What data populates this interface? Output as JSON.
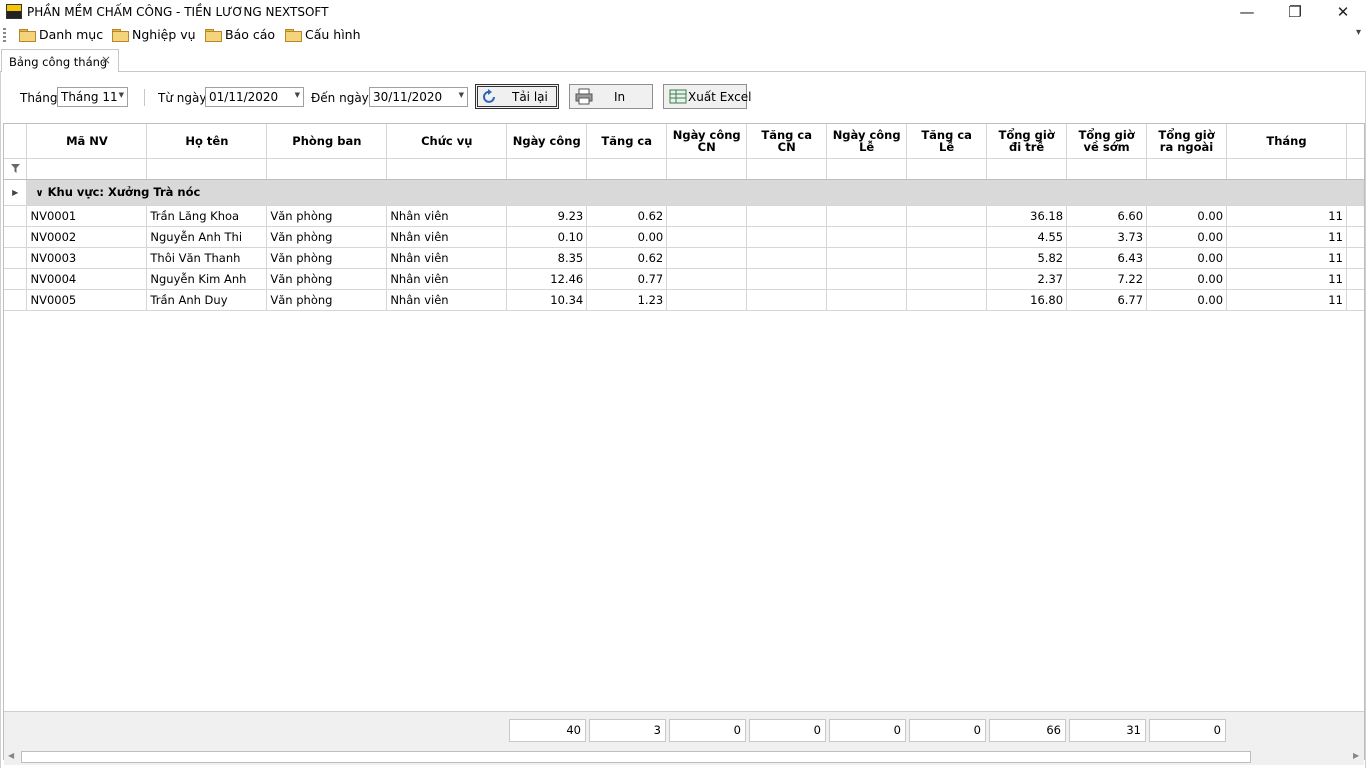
{
  "window": {
    "title": "PHẦN MỀM CHẤM CÔNG - TIỀN LƯƠNG NEXTSOFT",
    "minimize": "—",
    "restore": "❐",
    "close": "✕"
  },
  "menu": {
    "items": [
      "Danh mục",
      "Nghiệp vụ",
      "Báo cáo",
      "Cấu hình"
    ],
    "chevron": "▾"
  },
  "tab": {
    "label": "Bảng công tháng",
    "close": "×"
  },
  "toolbar": {
    "month_label": "Tháng",
    "month_value": "Tháng 11",
    "from_label": "Từ ngày",
    "from_value": "01/11/2020",
    "to_label": "Đến ngày",
    "to_value": "30/11/2020",
    "reload": "Tải lại",
    "print": "In",
    "excel": "Xuất Excel"
  },
  "grid": {
    "columns": [
      {
        "l1": "Mã NV",
        "l2": ""
      },
      {
        "l1": "Họ tên",
        "l2": ""
      },
      {
        "l1": "Phòng ban",
        "l2": ""
      },
      {
        "l1": "Chức vụ",
        "l2": ""
      },
      {
        "l1": "Ngày công",
        "l2": ""
      },
      {
        "l1": "Tăng ca",
        "l2": ""
      },
      {
        "l1": "Ngày công",
        "l2": "CN"
      },
      {
        "l1": "Tăng ca",
        "l2": "CN"
      },
      {
        "l1": "Ngày công",
        "l2": "Lễ"
      },
      {
        "l1": "Tăng ca",
        "l2": "Lễ"
      },
      {
        "l1": "Tổng giờ",
        "l2": "đi trễ"
      },
      {
        "l1": "Tổng giờ",
        "l2": "về sớm"
      },
      {
        "l1": "Tổng giờ",
        "l2": "ra ngoài"
      },
      {
        "l1": "Tháng",
        "l2": ""
      }
    ],
    "group": "Khu vực: Xưởng Trà nóc",
    "rows": [
      [
        "NV0001",
        "Trần Lăng Khoa",
        "Văn phòng",
        "Nhân viên",
        "9.23",
        "0.62",
        "",
        "",
        "",
        "",
        "36.18",
        "6.60",
        "0.00",
        "11"
      ],
      [
        "NV0002",
        "Nguyễn Anh Thi",
        "Văn phòng",
        "Nhân viên",
        "0.10",
        "0.00",
        "",
        "",
        "",
        "",
        "4.55",
        "3.73",
        "0.00",
        "11"
      ],
      [
        "NV0003",
        "Thôi Văn Thanh",
        "Văn phòng",
        "Nhân viên",
        "8.35",
        "0.62",
        "",
        "",
        "",
        "",
        "5.82",
        "6.43",
        "0.00",
        "11"
      ],
      [
        "NV0004",
        "Nguyễn Kim Anh",
        "Văn phòng",
        "Nhân viên",
        "12.46",
        "0.77",
        "",
        "",
        "",
        "",
        "2.37",
        "7.22",
        "0.00",
        "11"
      ],
      [
        "NV0005",
        "Trần Anh Duy",
        "Văn phòng",
        "Nhân viên",
        "10.34",
        "1.23",
        "",
        "",
        "",
        "",
        "16.80",
        "6.77",
        "0.00",
        "11"
      ]
    ],
    "totals": [
      "40",
      "3",
      "0",
      "0",
      "0",
      "0",
      "66",
      "31",
      "0"
    ]
  },
  "icons": {
    "app": "app-icon",
    "folder": "folder-icon",
    "filter": "filter-icon",
    "expand": "chevron-down-icon",
    "reload": "refresh-icon",
    "print": "printer-icon",
    "excel": "excel-icon"
  }
}
